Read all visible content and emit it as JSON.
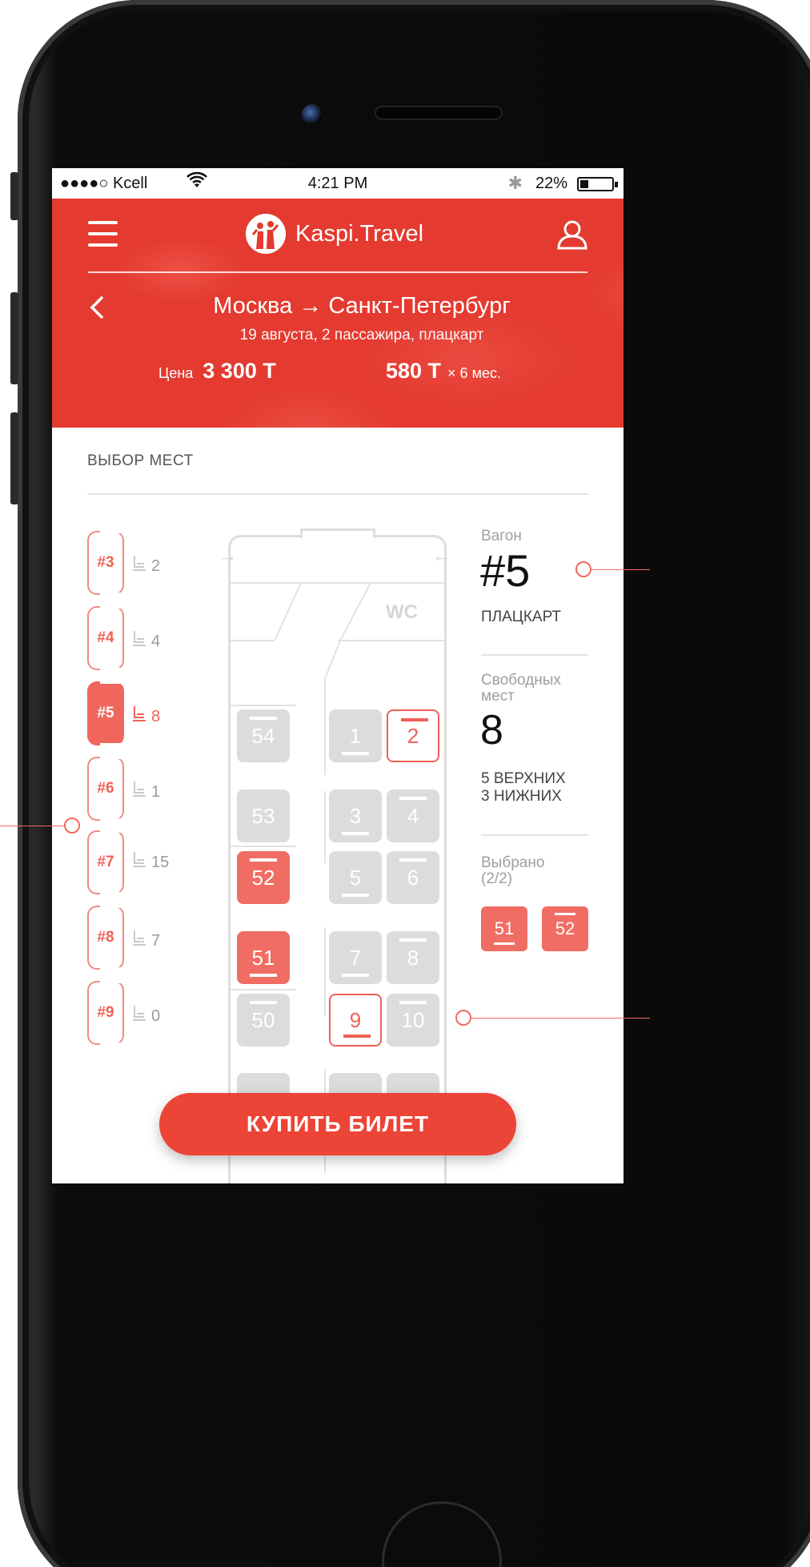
{
  "status_bar": {
    "carrier": "●●●●○ Kcell",
    "time": "4:21 PM",
    "battery": "22%"
  },
  "header": {
    "brand": "Kaspi.Travel",
    "route": "Москва → Санкт-Петербург",
    "details": "19 августа, 2 пассажира, плацкарт",
    "price_label": "Цена",
    "price_value": "3 300 Т",
    "monthly_value": "580 Т",
    "monthly_suffix": "× 6 мес."
  },
  "section": {
    "title": "ВЫБОР МЕСТ"
  },
  "wagons": [
    {
      "label": "#3",
      "free": "2",
      "active": false
    },
    {
      "label": "#4",
      "free": "4",
      "active": false
    },
    {
      "label": "#5",
      "free": "8",
      "active": true
    },
    {
      "label": "#6",
      "free": "1",
      "active": false
    },
    {
      "label": "#7",
      "free": "15",
      "active": false
    },
    {
      "label": "#8",
      "free": "7",
      "active": false
    },
    {
      "label": "#9",
      "free": "0",
      "active": false
    }
  ],
  "carriage": {
    "wc_label": "WC",
    "seats": [
      {
        "n": "54",
        "state": "taken",
        "pos": "upper"
      },
      {
        "n": "1",
        "state": "taken",
        "pos": "lower"
      },
      {
        "n": "2",
        "state": "available",
        "pos": "upper"
      },
      {
        "n": "53",
        "state": "taken",
        "pos": "none"
      },
      {
        "n": "3",
        "state": "taken",
        "pos": "lower"
      },
      {
        "n": "4",
        "state": "taken",
        "pos": "upper"
      },
      {
        "n": "52",
        "state": "selected",
        "pos": "upper"
      },
      {
        "n": "5",
        "state": "taken",
        "pos": "lower"
      },
      {
        "n": "6",
        "state": "taken",
        "pos": "upper"
      },
      {
        "n": "51",
        "state": "selected",
        "pos": "lower"
      },
      {
        "n": "7",
        "state": "taken",
        "pos": "lower"
      },
      {
        "n": "8",
        "state": "taken",
        "pos": "upper"
      },
      {
        "n": "50",
        "state": "taken",
        "pos": "upper"
      },
      {
        "n": "9",
        "state": "available",
        "pos": "lower"
      },
      {
        "n": "10",
        "state": "taken",
        "pos": "upper"
      }
    ]
  },
  "info": {
    "wagon_label": "Вагон",
    "wagon_number": "#5",
    "wagon_type": "ПЛАЦКАРТ",
    "free_label_1": "Свободных",
    "free_label_2": "мест",
    "free_count": "8",
    "free_upper": "5 ВЕРХНИХ",
    "free_lower": "3 НИЖНИХ",
    "chosen_label_1": "Выбрано",
    "chosen_label_2": "(2/2)",
    "chosen": [
      {
        "n": "51",
        "pos": "lower"
      },
      {
        "n": "52",
        "pos": "upper"
      }
    ]
  },
  "buy_button": "КУПИТЬ БИЛЕТ",
  "colors": {
    "brand_red": "#e43a30",
    "seat_selected": "#f06d63",
    "seat_taken": "#dcdcdc"
  }
}
